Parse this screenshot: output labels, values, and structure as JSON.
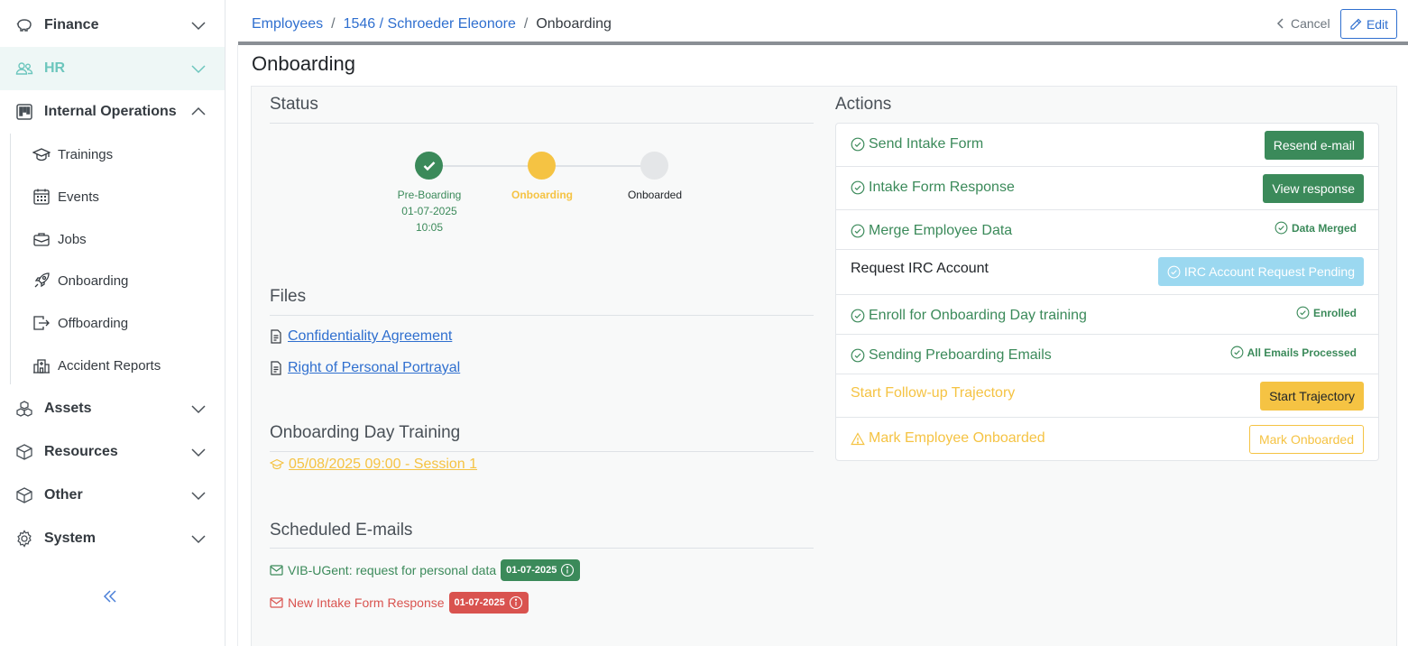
{
  "sidebar": {
    "groups": [
      {
        "label": "Finance",
        "icon": "piggy-bank-icon"
      },
      {
        "label": "HR",
        "icon": "people-icon"
      },
      {
        "label": "Internal Operations",
        "icon": "kanban-icon"
      },
      {
        "label": "Assets",
        "icon": "boxes-icon"
      },
      {
        "label": "Resources",
        "icon": "box-icon"
      },
      {
        "label": "Other",
        "icon": "box-icon"
      },
      {
        "label": "System",
        "icon": "gear-icon"
      }
    ],
    "sub_items": [
      {
        "label": "Trainings",
        "icon": "mortarboard-icon"
      },
      {
        "label": "Events",
        "icon": "calendar-icon"
      },
      {
        "label": "Jobs",
        "icon": "briefcase-icon"
      },
      {
        "label": "Onboarding",
        "icon": "rocket-icon"
      },
      {
        "label": "Offboarding",
        "icon": "box-arrow-right-icon"
      },
      {
        "label": "Accident Reports",
        "icon": "hospital-icon"
      }
    ]
  },
  "breadcrumb": {
    "items": [
      "Employees",
      "1546 / Schroeder Eleonore"
    ],
    "current": "Onboarding"
  },
  "header": {
    "cancel_label": "Cancel",
    "edit_label": "Edit"
  },
  "page": {
    "title": "Onboarding"
  },
  "status": {
    "title": "Status",
    "steps": [
      {
        "label": "Pre-Boarding",
        "date": "01-07-2025",
        "time": "10:05",
        "state": "done"
      },
      {
        "label": "Onboarding",
        "state": "current"
      },
      {
        "label": "Onboarded",
        "state": "pending"
      }
    ]
  },
  "files": {
    "title": "Files",
    "items": [
      "Confidentiality Agreement",
      "Right of Personal Portrayal"
    ]
  },
  "training": {
    "title": "Onboarding Day Training",
    "session": "05/08/2025 09:00 - Session 1"
  },
  "emails": {
    "title": "Scheduled E-mails",
    "items": [
      {
        "label": "VIB-UGent: request for personal data",
        "date": "01-07-2025",
        "status": "sent"
      },
      {
        "label": "New Intake Form Response",
        "date": "01-07-2025",
        "status": "failed"
      }
    ]
  },
  "actions": {
    "title": "Actions",
    "rows": [
      {
        "label": "Send Intake Form",
        "button": "Resend e-mail"
      },
      {
        "label": "Intake Form Response",
        "button": "View response"
      },
      {
        "label": "Merge Employee Data",
        "status": "Data Merged"
      },
      {
        "label": "Request IRC Account",
        "button": "IRC Account Request Pending"
      },
      {
        "label": "Enroll for Onboarding Day training",
        "status": "Enrolled"
      },
      {
        "label": "Sending Preboarding Emails",
        "status": "All Emails Processed"
      },
      {
        "label": "Start Follow-up Trajectory",
        "button": "Start Trajectory"
      },
      {
        "label": "Mark Employee Onboarded",
        "button": "Mark Onboarded"
      }
    ]
  },
  "colors": {
    "green": "#3b8a5a",
    "yellow": "#f5c343",
    "link_blue": "#2f6fcf",
    "info_light": "#9bd8f0",
    "red": "#d9534f",
    "hr_accent": "#6cc6bd"
  }
}
